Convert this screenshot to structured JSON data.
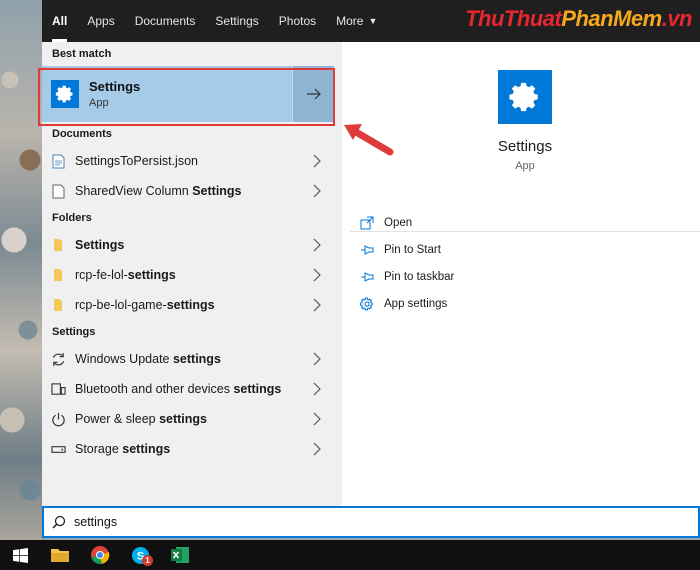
{
  "tabs": [
    {
      "label": "All",
      "active": true
    },
    {
      "label": "Apps"
    },
    {
      "label": "Documents"
    },
    {
      "label": "Settings"
    },
    {
      "label": "Photos"
    },
    {
      "label": "More"
    }
  ],
  "brand": {
    "part1": "ThuThuat",
    "part2": "PhanMem",
    "part3": ".vn"
  },
  "sections": {
    "best_match": "Best match",
    "documents": "Documents",
    "folders": "Folders",
    "settings": "Settings"
  },
  "best_match": {
    "title": "Settings",
    "subtitle": "App"
  },
  "documents": [
    {
      "plain": "SettingsToPersist.json",
      "bold": ""
    },
    {
      "plain": "SharedView Column ",
      "bold": "Settings"
    }
  ],
  "folders": [
    {
      "plain": "",
      "bold": "Settings"
    },
    {
      "plain": "rcp-fe-lol-",
      "bold": "settings"
    },
    {
      "plain": "rcp-be-lol-game-",
      "bold": "settings"
    }
  ],
  "settings_items": [
    {
      "plain": "Windows Update ",
      "bold": "settings",
      "icon": "sync-icon"
    },
    {
      "plain": "Bluetooth and other devices ",
      "bold": "settings",
      "icon": "devices-icon"
    },
    {
      "plain": "Power & sleep ",
      "bold": "settings",
      "icon": "power-icon"
    },
    {
      "plain": "Storage ",
      "bold": "settings",
      "icon": "storage-icon"
    }
  ],
  "preview": {
    "title": "Settings",
    "subtitle": "App"
  },
  "actions": [
    {
      "label": "Open",
      "icon": "open-icon"
    },
    {
      "label": "Pin to Start",
      "icon": "pin-icon"
    },
    {
      "label": "Pin to taskbar",
      "icon": "pin-icon"
    },
    {
      "label": "App settings",
      "icon": "gear-icon"
    }
  ],
  "search": {
    "value": "settings"
  },
  "taskbar": {
    "badge_count": "1"
  },
  "colors": {
    "accent": "#0078d7",
    "highlight": "#a6cbe8",
    "annotation": "#e03b3b"
  }
}
